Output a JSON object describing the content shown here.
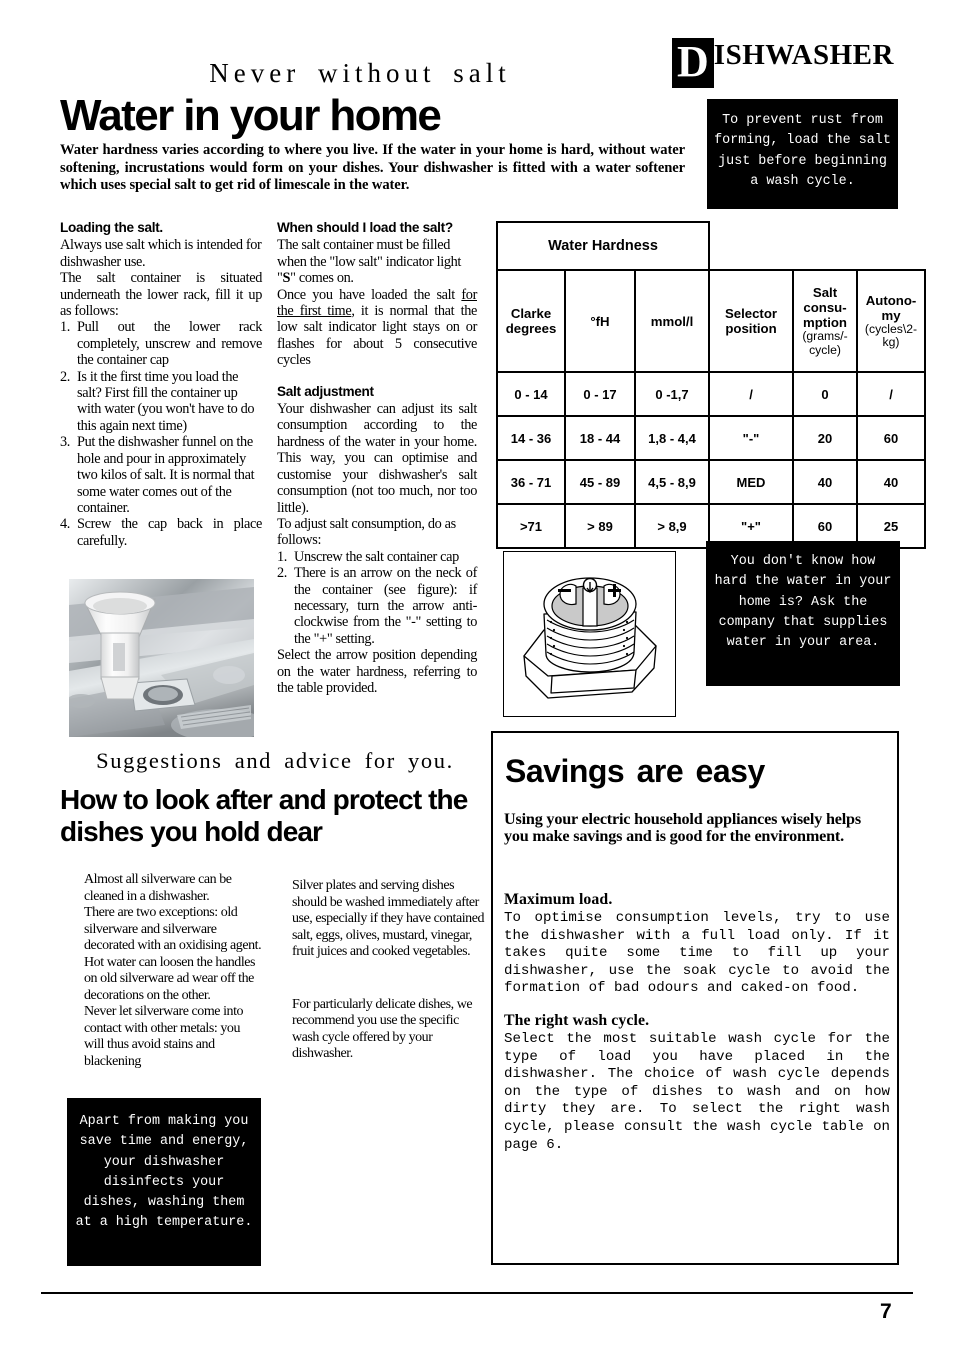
{
  "header": {
    "logo_initial": "D",
    "logo_rest": "ISHWASHER",
    "kicker": "Never without salt",
    "title": "Water in your home",
    "intro": "Water hardness varies according to where you live. If the water in your home is hard, without water softening, incrustations would form on your dishes. Your dishwasher is fitted with a water softener which uses special salt to get rid of limescale in the water."
  },
  "callouts": {
    "prevent_rust": "To prevent rust from forming, load the salt just before beginning a wash cycle.",
    "water_hardness_ask": "You don't know how hard the water in your home is? Ask the company that supplies water in your area.",
    "disinfects": "Apart from making you save time and energy, your dishwasher disinfects your dishes, washing them at a high temperature."
  },
  "loading_salt": {
    "heading": "Loading the salt.",
    "p1": "Always use salt which is intended for dishwasher use.",
    "p2": "The salt container is situated underneath the lower rack, fill it up as follows:",
    "steps": [
      {
        "num": "1.",
        "text": "Pull out the lower rack completely, unscrew and remove the container cap"
      },
      {
        "num": "2.",
        "text": "Is it the first time you load the salt? First fill the container up with water (you won't have to do this again next time)"
      },
      {
        "num": "3.",
        "text": "Put the dishwasher funnel on the hole and pour in approximately two kilos of salt. It is normal that some water comes out of the container."
      },
      {
        "num": "4.",
        "text": "Screw the cap back in place carefully."
      }
    ]
  },
  "when_load": {
    "heading": "When should I load the salt?",
    "p1_a": "The salt container must be filled when the \"low salt\" indicator light \"",
    "p1_bold": "S",
    "p1_b": "\" comes on.",
    "p2_a": "Once you have loaded the salt ",
    "p2_underline": "for the first time",
    "p2_b": ", it is normal that the low salt indicator light stays on or flashes for about 5 consecutive cycles"
  },
  "salt_adjustment": {
    "heading": "Salt adjustment",
    "p1": "Your dishwasher can adjust its salt consumption according to the hardness of the water in your home. This way, you can optimise and customise your dishwasher's salt consumption (not too much, nor too little).",
    "p2": "To adjust salt consumption, do as follows:",
    "steps": [
      {
        "num": "1.",
        "text": "Unscrew the salt container cap"
      },
      {
        "num": "2.",
        "text": "There is an arrow on the neck of the container (see figure): if necessary, turn the arrow anti-clockwise from the \"-\" setting to the \"+\" setting."
      }
    ],
    "p3": "Select the arrow position depending on the water hardness, referring to the table provided."
  },
  "cap_diagram": {
    "minus_label": "–",
    "plus_label": "+"
  },
  "table": {
    "group_header": "Water Hardness",
    "columns": [
      {
        "label": "Clarke degrees",
        "note": ""
      },
      {
        "label": "°fH",
        "note": ""
      },
      {
        "label": "mmol/l",
        "note": ""
      },
      {
        "label": "Selector position",
        "note": ""
      },
      {
        "label": "Salt consu-mption",
        "note": "(grams/-cycle)"
      },
      {
        "label": "Autono-my",
        "note": "(cycles\\2-kg)"
      }
    ],
    "rows": [
      [
        "0 - 14",
        "0 - 17",
        "0 -1,7",
        "/",
        "0",
        "/"
      ],
      [
        "14 - 36",
        "18 - 44",
        "1,8 - 4,4",
        "\"-\"",
        "20",
        "60"
      ],
      [
        "36 - 71",
        "45 -  89",
        "4,5 -  8,9",
        "MED",
        "40",
        "40"
      ],
      [
        ">71",
        "> 89",
        "> 8,9",
        "\"+\"",
        "60",
        "25"
      ]
    ]
  },
  "care": {
    "kicker": "Suggestions and advice for you.",
    "title": "How to look after and protect the dishes you hold dear",
    "col1_p1": "Almost all silverware can be cleaned in a dishwasher.",
    "col1_p2": "There are two exceptions: old silverware and silverware decorated with an oxidising agent. Hot water can loosen the handles on old silverware ad wear off the decorations on the other.",
    "col1_p3": "Never let silverware come into contact with other metals: you will thus avoid stains and blackening",
    "col2_p1": "Silver plates and serving dishes should be washed immediately after use, especially if they have contained salt, eggs, olives, mustard, vinegar, fruit juices and cooked vegetables.",
    "col2_p2": "For particularly delicate dishes, we recommend you use the specific wash cycle offered by your dishwasher."
  },
  "savings": {
    "title": "Savings are easy",
    "lead": "Using your electric household appliances wisely helps you make savings and is good for the environment.",
    "max_load_heading": "Maximum  load.",
    "max_load_body": "To optimise consumption levels, try to use the dishwasher with a full load only. If it takes quite some time to fill up your dishwasher, use the soak cycle to avoid the formation of bad odours and caked-on food.",
    "right_cycle_heading": "The right wash cycle.",
    "right_cycle_body": "Select the most suitable wash cycle for the type of load you have placed in the dishwasher. The choice of wash cycle depends on the type of dishes to wash and on how dirty they are. To select the right wash cycle, please consult the wash cycle table on page 6."
  },
  "footer": {
    "page_number": "7"
  },
  "colors": {
    "ink": "#000000",
    "paper": "#ffffff",
    "callout_bg": "#000000",
    "callout_text": "#ffffff"
  }
}
